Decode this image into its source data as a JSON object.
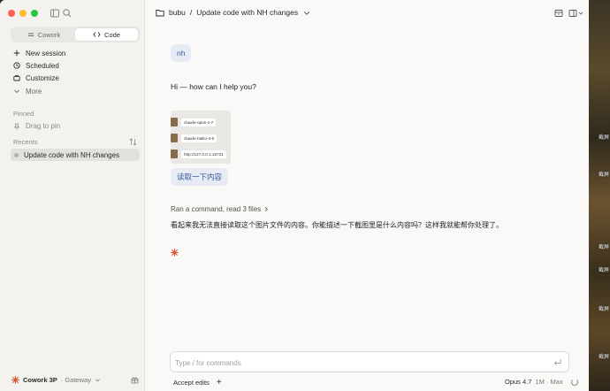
{
  "sidebar": {
    "segments": [
      {
        "label": "Cowork",
        "active": false
      },
      {
        "label": "Code",
        "active": true
      }
    ],
    "nav": [
      {
        "label": "New session",
        "icon": "plus-icon"
      },
      {
        "label": "Scheduled",
        "icon": "clock-icon"
      },
      {
        "label": "Customize",
        "icon": "briefcase-icon"
      },
      {
        "label": "More",
        "icon": "chevron-down-icon"
      }
    ],
    "pinned_label": "Pinned",
    "pin_hint": "Drag to pin",
    "recents_label": "Recents",
    "recent_items": [
      "Update code with NH changes"
    ],
    "account": {
      "name": "Cowork 3P",
      "sub": "· Gateway"
    }
  },
  "header": {
    "folder": "bubu",
    "separator": "/",
    "title": "Update code with NH changes"
  },
  "chat": {
    "user_message_1": "nh",
    "assistant_greeting": "Hi — how can I help you?",
    "attachment_rows": [
      "claude-opus-4-7",
      "claude-haiku-4-5",
      "http://127.0.0.1:15721"
    ],
    "user_message_2": "读取一下内容",
    "tool_summary": "Ran a command, read 3 files",
    "assistant_answer": "看起来我无法直接读取这个图片文件的内容。你能描述一下截图里是什么内容吗？这样我就能帮你处理了。"
  },
  "composer": {
    "placeholder": "Type / for commands",
    "accept_edits": "Accept edits",
    "add": "+",
    "model": "Opus 4.7",
    "model_sub": "1M · Max"
  },
  "wallpaper_labels": [
    "截屏",
    "截屏",
    "截屏",
    "截屏",
    "截屏",
    "截屏"
  ],
  "colors": {
    "accent_blue": "#3b5a9a",
    "bubble_bg": "#e6ebf6",
    "spark": "#d9552f"
  }
}
